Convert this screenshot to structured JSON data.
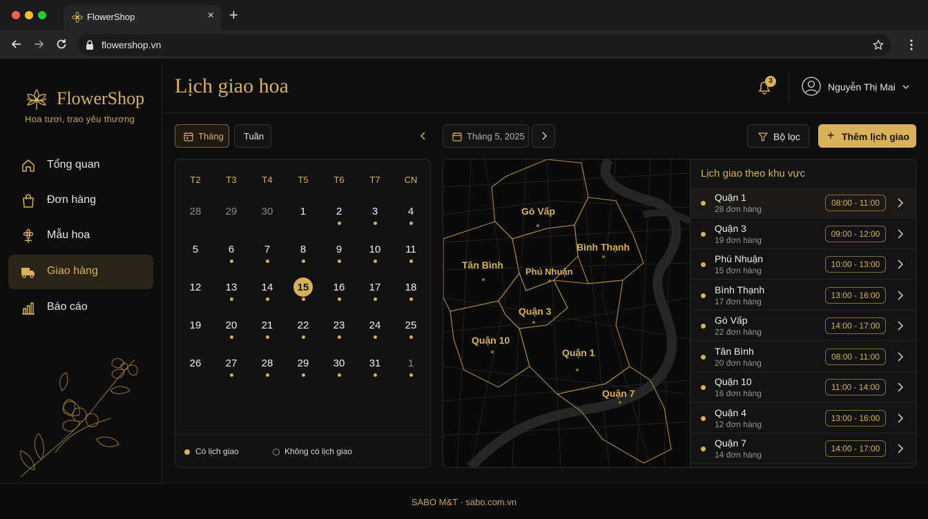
{
  "browser": {
    "tab_title": "FlowerShop",
    "url": "flowershop.vn"
  },
  "sidebar": {
    "brand": "FlowerShop",
    "tagline": "Hoa tươi, trao yêu thương",
    "items": [
      {
        "label": "Tổng quan",
        "icon": "home-icon"
      },
      {
        "label": "Đơn hàng",
        "icon": "shopping-bag-icon"
      },
      {
        "label": "Mẫu hoa",
        "icon": "flower-icon"
      },
      {
        "label": "Giao hàng",
        "icon": "truck-icon",
        "active": true
      },
      {
        "label": "Báo cáo",
        "icon": "bar-chart-icon"
      }
    ]
  },
  "header": {
    "title": "Lịch giao hoa",
    "notification_count": "3",
    "user_name": "Nguyễn Thị Mai"
  },
  "toolbar": {
    "view_month": "Tháng",
    "view_week": "Tuần",
    "current_period": "Tháng 5, 2025",
    "filter": "Bộ lọc",
    "add": "Thêm lịch giao"
  },
  "calendar": {
    "weekdays": [
      "T2",
      "T3",
      "T4",
      "T5",
      "T6",
      "T7",
      "CN"
    ],
    "weeks": [
      [
        {
          "d": "28",
          "m": 1,
          "dot": 0
        },
        {
          "d": "29",
          "m": 1,
          "dot": 0
        },
        {
          "d": "30",
          "m": 1,
          "dot": 0
        },
        {
          "d": "1",
          "m": 0,
          "dot": 0
        },
        {
          "d": "2",
          "m": 0,
          "dot": 1
        },
        {
          "d": "3",
          "m": 0,
          "dot": 1
        },
        {
          "d": "4",
          "m": 0,
          "dot": 1
        }
      ],
      [
        {
          "d": "5",
          "m": 0,
          "dot": 0
        },
        {
          "d": "6",
          "m": 0,
          "dot": 1
        },
        {
          "d": "7",
          "m": 0,
          "dot": 1
        },
        {
          "d": "8",
          "m": 0,
          "dot": 1
        },
        {
          "d": "9",
          "m": 0,
          "dot": 1
        },
        {
          "d": "10",
          "m": 0,
          "dot": 1
        },
        {
          "d": "11",
          "m": 0,
          "dot": 1
        }
      ],
      [
        {
          "d": "12",
          "m": 0,
          "dot": 0
        },
        {
          "d": "13",
          "m": 0,
          "dot": 1
        },
        {
          "d": "14",
          "m": 0,
          "dot": 1
        },
        {
          "d": "15",
          "m": 0,
          "dot": 1,
          "today": 1
        },
        {
          "d": "16",
          "m": 0,
          "dot": 1
        },
        {
          "d": "17",
          "m": 0,
          "dot": 1
        },
        {
          "d": "18",
          "m": 0,
          "dot": 1
        }
      ],
      [
        {
          "d": "19",
          "m": 0,
          "dot": 0
        },
        {
          "d": "20",
          "m": 0,
          "dot": 1
        },
        {
          "d": "21",
          "m": 0,
          "dot": 1
        },
        {
          "d": "22",
          "m": 0,
          "dot": 1
        },
        {
          "d": "23",
          "m": 0,
          "dot": 1
        },
        {
          "d": "24",
          "m": 0,
          "dot": 1
        },
        {
          "d": "25",
          "m": 0,
          "dot": 1
        }
      ],
      [
        {
          "d": "26",
          "m": 0,
          "dot": 0
        },
        {
          "d": "27",
          "m": 0,
          "dot": 1
        },
        {
          "d": "28",
          "m": 0,
          "dot": 1
        },
        {
          "d": "29",
          "m": 0,
          "dot": 1
        },
        {
          "d": "30",
          "m": 0,
          "dot": 1
        },
        {
          "d": "31",
          "m": 0,
          "dot": 1
        },
        {
          "d": "1",
          "m": 1,
          "dot": 1
        }
      ]
    ],
    "legend_has": "Có lịch giao",
    "legend_none": "Không có lịch giao"
  },
  "map": {
    "districts": [
      "Gò Vấp",
      "Bình Thạnh",
      "Tân Bình",
      "Phú Nhuận",
      "Quận 3",
      "Quận 10",
      "Quận 1",
      "Quận 7"
    ]
  },
  "regions": {
    "title": "Lịch giao theo khu vực",
    "items": [
      {
        "name": "Quận 1",
        "count": "28 đơn hàng",
        "time": "08:00 - 11:00"
      },
      {
        "name": "Quận 3",
        "count": "19 đơn hàng",
        "time": "09:00 - 12:00"
      },
      {
        "name": "Phú Nhuận",
        "count": "15 đơn hàng",
        "time": "10:00 - 13:00"
      },
      {
        "name": "Bình Thạnh",
        "count": "17 đơn hàng",
        "time": "13:00 - 16:00"
      },
      {
        "name": "Gò Vấp",
        "count": "22 đơn hàng",
        "time": "14:00 - 17:00"
      },
      {
        "name": "Tân Bình",
        "count": "20 đơn hàng",
        "time": "08:00 - 11:00"
      },
      {
        "name": "Quận 10",
        "count": "16 đơn hàng",
        "time": "11:00 - 14:00"
      },
      {
        "name": "Quận 4",
        "count": "12 đơn hàng",
        "time": "13:00 - 16:00"
      },
      {
        "name": "Quận 7",
        "count": "14 đơn hàng",
        "time": "14:00 - 17:00"
      }
    ]
  },
  "footer": "SABO M&T · sabo.com.vn",
  "colors": {
    "accent": "#d8b15a",
    "background": "#0e0e0e"
  }
}
